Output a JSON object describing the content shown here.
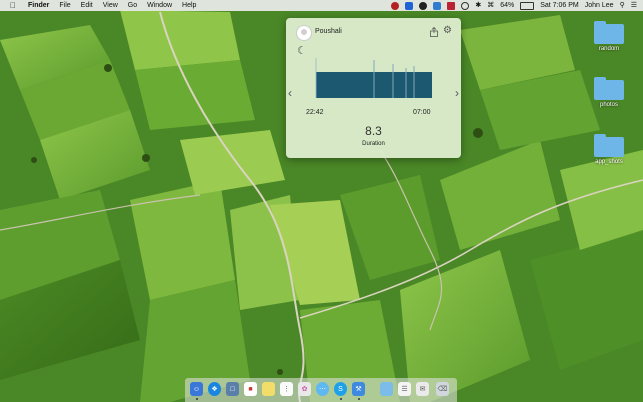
{
  "menubar": {
    "apple": "",
    "menus": [
      "Finder",
      "File",
      "Edit",
      "View",
      "Go",
      "Window",
      "Help"
    ],
    "battery": "64%",
    "clock": "Sat 7:06 PM",
    "user": "John Lee",
    "icons": [
      "sleep-tracker-icon",
      "dropbox-icon",
      "evernote-icon",
      "screenshot-icon",
      "vpn-icon",
      "time-machine-icon",
      "bluetooth-icon",
      "wifi-icon",
      "battery-icon",
      "search-icon",
      "list-icon"
    ]
  },
  "desktop": {
    "folders": [
      {
        "label": "random"
      },
      {
        "label": "photos"
      },
      {
        "label": "app_shots"
      }
    ]
  },
  "popover": {
    "user": "Poushali",
    "share_icon": "share-icon",
    "settings_icon": "gear-icon",
    "moon_icon": "moon-icon",
    "start_time": "22:42",
    "end_time": "07:00",
    "duration_value": "8.3",
    "duration_label": "Duration",
    "chart_color": "#1c5870",
    "marker_color": "#7fa8b8"
  },
  "dock": {
    "apps": [
      "finder",
      "safari",
      "preview",
      "calendar",
      "notes",
      "reminders",
      "photos",
      "messages",
      "skype",
      "xcode",
      "downloads-folder",
      "documents",
      "mail-drafts",
      "trash"
    ]
  }
}
